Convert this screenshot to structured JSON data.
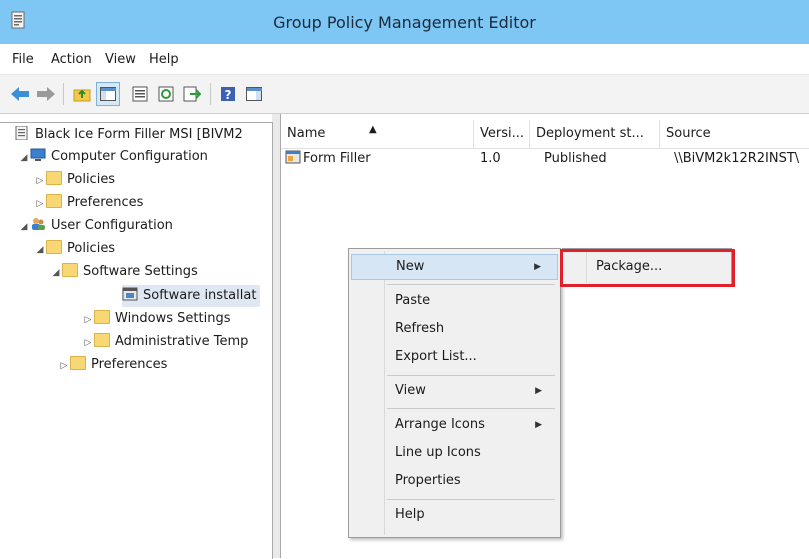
{
  "window": {
    "title": "Group Policy Management Editor"
  },
  "menubar": {
    "items": [
      "File",
      "Action",
      "View",
      "Help"
    ]
  },
  "toolbar": {
    "icons": [
      "back-arrow-icon",
      "forward-arrow-icon",
      "up-folder-icon",
      "show-hide-tree-icon",
      "properties-icon",
      "refresh-icon",
      "export-list-icon",
      "help-icon",
      "show-hide-action-pane-icon"
    ]
  },
  "tree": {
    "root": "Black Ice Form Filler MSI [BIVM2",
    "computer_config": "Computer Configuration",
    "cc_policies": "Policies",
    "cc_preferences": "Preferences",
    "user_config": "User Configuration",
    "uc_policies": "Policies",
    "software_settings": "Software Settings",
    "software_installation": "Software installat",
    "windows_settings": "Windows Settings",
    "admin_templates": "Administrative Temp",
    "uc_preferences": "Preferences"
  },
  "list": {
    "columns": [
      "Name",
      "Versi...",
      "Deployment st...",
      "Source"
    ],
    "rows": [
      {
        "name": "Form Filler",
        "version": "1.0",
        "deployment": "Published",
        "source": "\\\\BiVM2k12R2INST\\"
      }
    ]
  },
  "context_menu": {
    "items": [
      "New",
      "Paste",
      "Refresh",
      "Export List...",
      "View",
      "Arrange Icons",
      "Line up Icons",
      "Properties",
      "Help"
    ],
    "submenu": {
      "items": [
        "Package..."
      ]
    }
  },
  "colors": {
    "titlebar": "#7ec6f4",
    "highlight_box": "#e0202a",
    "menu_highlight": "#d7e6f5"
  }
}
